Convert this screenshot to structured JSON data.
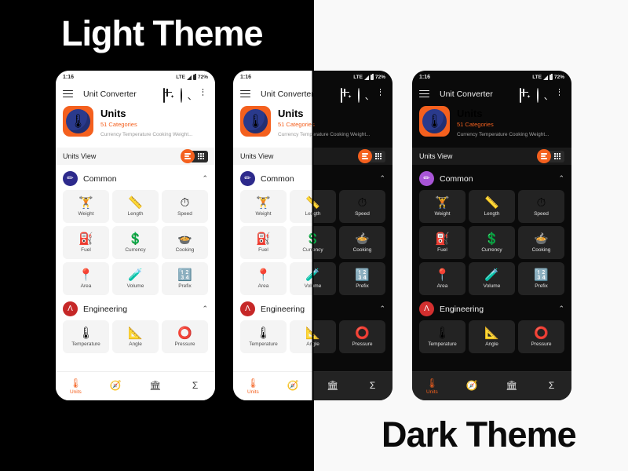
{
  "page": {
    "light_theme_title": "Light Theme",
    "dark_theme_title": "Dark Theme",
    "bg_left": "#000000",
    "bg_right": "#f9f9f9",
    "accent": "#f4601e"
  },
  "status_bar": {
    "time": "1:16",
    "network": "LTE",
    "battery_percent": "72%"
  },
  "app_bar": {
    "title": "Unit Converter",
    "menu_icon": "hamburger-icon",
    "grid_icon": "grid-star-icon",
    "search_icon": "search-icon",
    "overflow_icon": "kebab-menu-icon"
  },
  "hero": {
    "icon": "thermometer-app-icon",
    "icon_glyph": "🌡",
    "title": "Units",
    "categories": "51 Categories",
    "description": "Currency Temperature Cooking Weight..."
  },
  "view_bar": {
    "label": "Units View",
    "list_toggle": "list-view-icon",
    "grid_toggle": "grid-view-icon",
    "active": "list"
  },
  "sections": [
    {
      "name": "Common",
      "badge_glyph": "✏",
      "badge_color_light": "#2d2a8c",
      "badge_color_dark": "#a855d6",
      "chevron": "⌃",
      "tiles": [
        {
          "label": "Weight",
          "emoji": "🏋"
        },
        {
          "label": "Length",
          "emoji": "📏"
        },
        {
          "label": "Speed",
          "emoji": "⏱"
        },
        {
          "label": "Fuel",
          "emoji": "⛽"
        },
        {
          "label": "Currency",
          "emoji": "💲"
        },
        {
          "label": "Cooking",
          "emoji": "🍲"
        },
        {
          "label": "Area",
          "emoji": "📍"
        },
        {
          "label": "Volume",
          "emoji": "🧪"
        },
        {
          "label": "Prefix",
          "emoji": "🔢"
        }
      ]
    },
    {
      "name": "Engineering",
      "badge_glyph": "Λ",
      "badge_color_light": "#c62828",
      "badge_color_dark": "#d32f2f",
      "chevron": "⌃",
      "tiles": [
        {
          "label": "Temperature",
          "emoji": "🌡"
        },
        {
          "label": "Angle",
          "emoji": "📐"
        },
        {
          "label": "Pressure",
          "emoji": "⭕"
        }
      ]
    }
  ],
  "nav": [
    {
      "label": "Units",
      "icon": "thermometer-icon",
      "glyph": "🌡",
      "active": true
    },
    {
      "label": "",
      "icon": "compass-icon",
      "glyph": "🧭",
      "active": false
    },
    {
      "label": "",
      "icon": "bank-icon",
      "glyph": "🏛",
      "active": false
    },
    {
      "label": "",
      "icon": "sigma-icon",
      "glyph": "Σ",
      "active": false
    }
  ]
}
